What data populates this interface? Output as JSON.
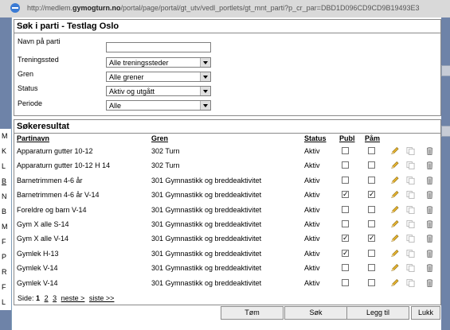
{
  "browser": {
    "url_prefix": "http://medlem.",
    "url_domain": "gymogturn.no",
    "url_suffix": "/portal/page/portal/gt_utv/vedl_portlets/gt_mnt_parti?p_cr_par=DBD1D096CD9CD9B19493E3"
  },
  "background": {
    "left_letters": [
      "M",
      "K",
      "L",
      "B",
      "N",
      "B",
      "M",
      "F",
      "P",
      "R",
      "F",
      "L"
    ]
  },
  "search": {
    "title": "Søk i parti - Testlag Oslo",
    "fields": {
      "name_label": "Navn på parti",
      "name_value": "",
      "venue_label": "Treningssted",
      "venue_value": "Alle treningssteder",
      "branch_label": "Gren",
      "branch_value": "Alle grener",
      "status_label": "Status",
      "status_value": "Aktiv og utgått",
      "period_label": "Periode",
      "period_value": "Alle"
    }
  },
  "results": {
    "title": "Søkeresultat",
    "headers": {
      "name": "Partinavn",
      "branch": "Gren",
      "status": "Status",
      "publ": "Publ",
      "pam": "Påm"
    },
    "rows": [
      {
        "name": "Apparaturn gutter 10-12",
        "branch": "302 Turn",
        "status": "Aktiv",
        "publ": false,
        "pam": false
      },
      {
        "name": "Apparaturn gutter 10-12 H 14",
        "branch": "302 Turn",
        "status": "Aktiv",
        "publ": false,
        "pam": false
      },
      {
        "name": "Barnetrimmen 4-6 år",
        "branch": "301 Gymnastikk og breddeaktivitet",
        "status": "Aktiv",
        "publ": false,
        "pam": false
      },
      {
        "name": "Barnetrimmen 4-6 år V-14",
        "branch": "301 Gymnastikk og breddeaktivitet",
        "status": "Aktiv",
        "publ": true,
        "pam": true
      },
      {
        "name": "Foreldre og barn V-14",
        "branch": "301 Gymnastikk og breddeaktivitet",
        "status": "Aktiv",
        "publ": false,
        "pam": false
      },
      {
        "name": "Gym X alle S-14",
        "branch": "301 Gymnastikk og breddeaktivitet",
        "status": "Aktiv",
        "publ": false,
        "pam": false
      },
      {
        "name": "Gym X alle V-14",
        "branch": "301 Gymnastikk og breddeaktivitet",
        "status": "Aktiv",
        "publ": true,
        "pam": true
      },
      {
        "name": "Gymlek H-13",
        "branch": "301 Gymnastikk og breddeaktivitet",
        "status": "Aktiv",
        "publ": true,
        "pam": false
      },
      {
        "name": "Gymlek V-14",
        "branch": "301 Gymnastikk og breddeaktivitet",
        "status": "Aktiv",
        "publ": false,
        "pam": false
      },
      {
        "name": "Gymlek V-14",
        "branch": "301 Gymnastikk og breddeaktivitet",
        "status": "Aktiv",
        "publ": false,
        "pam": false
      }
    ],
    "pager": {
      "label": "Side:",
      "current": "1",
      "pages": [
        "2",
        "3"
      ],
      "next": "neste >",
      "last": "siste >>"
    }
  },
  "buttons": {
    "clear": "Tøm",
    "search": "Søk",
    "add": "Legg til",
    "close": "Lukk"
  }
}
